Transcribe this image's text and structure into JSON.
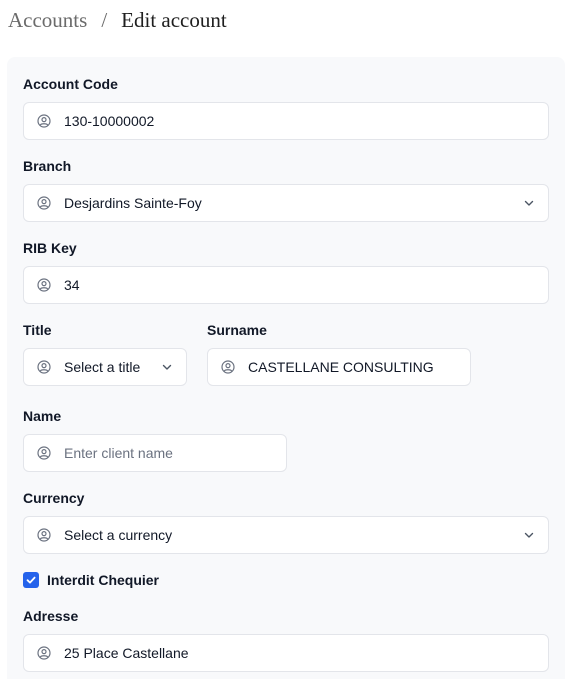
{
  "breadcrumb": {
    "parent": "Accounts",
    "separator": "/",
    "current": "Edit account"
  },
  "form": {
    "account_code": {
      "label": "Account Code",
      "value": "130-10000002",
      "icon": "user-circle-icon"
    },
    "branch": {
      "label": "Branch",
      "value": "Desjardins Sainte-Foy",
      "icon": "user-circle-icon"
    },
    "rib_key": {
      "label": "RIB Key",
      "value": "34",
      "icon": "user-circle-icon"
    },
    "title": {
      "label": "Title",
      "placeholder": "Select a title",
      "value": "",
      "icon": "user-circle-icon"
    },
    "surname": {
      "label": "Surname",
      "value": "CASTELLANE CONSULTING",
      "icon": "user-circle-icon"
    },
    "name": {
      "label": "Name",
      "placeholder": "Enter client name",
      "value": "",
      "icon": "user-circle-icon"
    },
    "currency": {
      "label": "Currency",
      "placeholder": "Select a currency",
      "value": "",
      "icon": "user-circle-icon"
    },
    "interdit_chequier": {
      "label": "Interdit Chequier",
      "checked": true
    },
    "adresse": {
      "label": "Adresse",
      "value": "25 Place Castellane",
      "icon": "user-circle-icon"
    }
  },
  "colors": {
    "accent": "#2563eb",
    "panel_bg": "#f8f9fb",
    "border": "#e3e5ea",
    "muted_text": "#6b7280"
  }
}
